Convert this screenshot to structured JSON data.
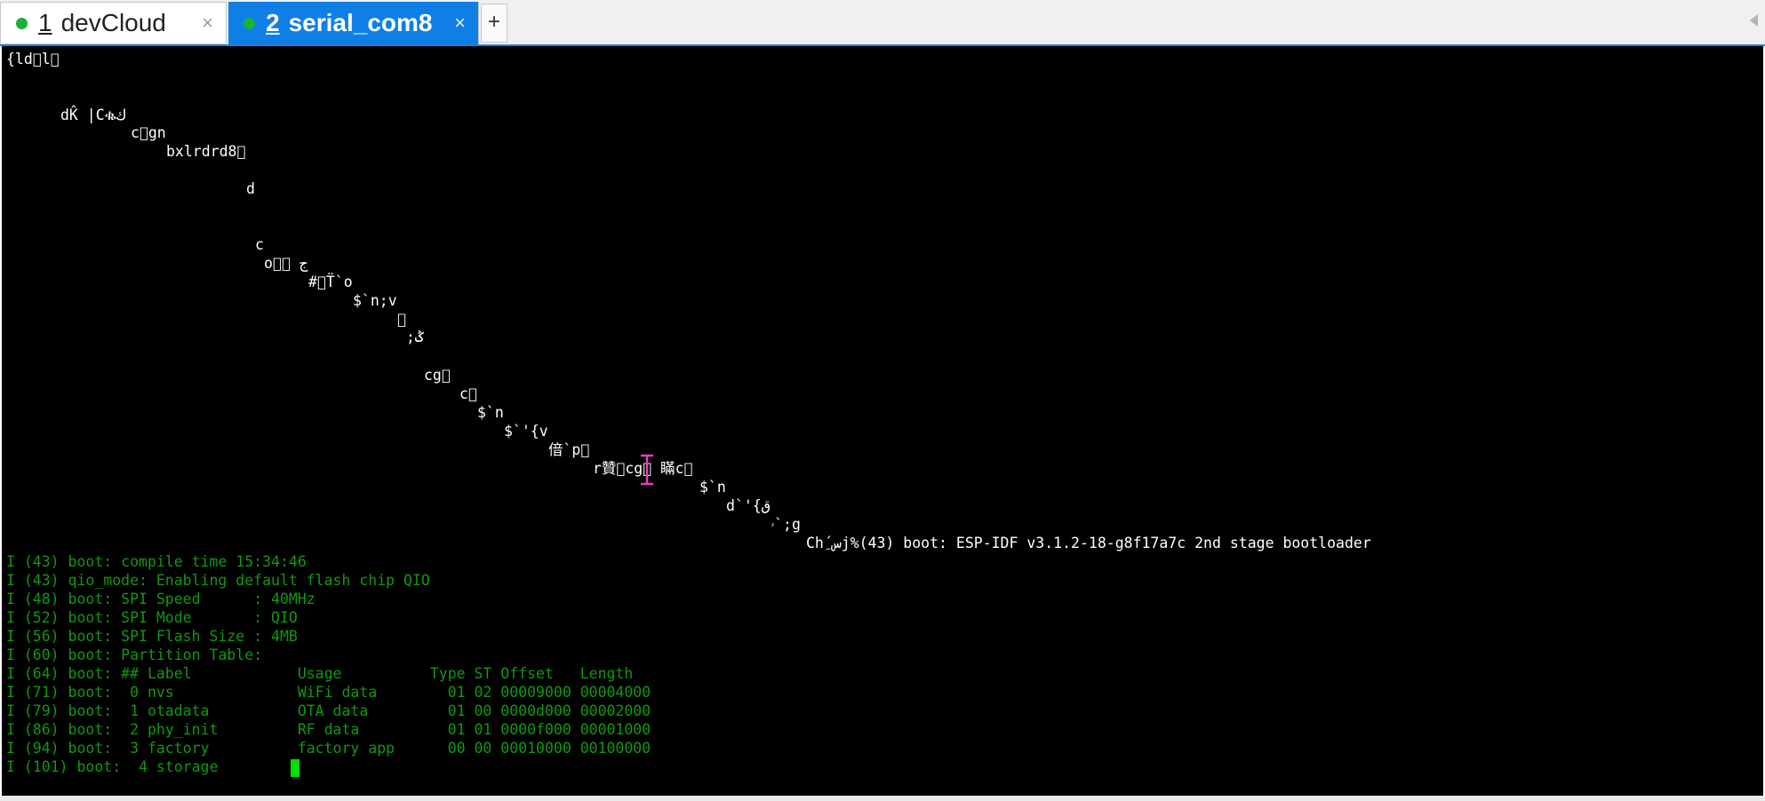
{
  "tabs": [
    {
      "number": "1",
      "title": "devCloud",
      "close": "×",
      "status_color": "#19b23a",
      "active": false
    },
    {
      "number": "2",
      "title": "serial_com8",
      "close": "×",
      "status_color": "#19b23a",
      "active": true
    }
  ],
  "new_tab_label": "+",
  "terminal": {
    "garbled": [
      "{ld\u0000l\u0000",
      "dK̂ |Cቈك",
      "c\u0000gn",
      "bxlrdrd8\u0000",
      "d",
      "c",
      "o\u0000㉘ ج",
      "#\u0000T̈`o",
      "$`n;v",
      "\u0000",
      ";ݣ",
      "cg\u0000",
      "c\u0000",
      "$`n",
      "$`'{v",
      "偣`p\u0000",
      "r贊\u0000cg\u0000 瞞c\u0000",
      "$`n",
      "d`'{ق",
      "ۥ`;g"
    ],
    "boot_header": "Ch´ِسj%(43) boot: ESP-IDF v3.1.2-18-g8f17a7c 2nd stage bootloader",
    "boot_lines": [
      "I (43) boot: compile time 15:34:46",
      "I (43) qio_mode: Enabling default flash chip QIO",
      "I (48) boot: SPI Speed      : 40MHz",
      "I (52) boot: SPI Mode       : QIO",
      "I (56) boot: SPI Flash Size : 4MB",
      "I (60) boot: Partition Table:",
      "I (64) boot: ## Label            Usage          Type ST Offset   Length",
      "I (71) boot:  0 nvs              WiFi data        01 02 00009000 00004000",
      "I (79) boot:  1 otadata          OTA data         01 00 0000d000 00002000",
      "I (86) boot:  2 phy_init         RF data          01 01 0000f000 00001000",
      "I (94) boot:  3 factory          factory app      00 00 00010000 00100000",
      "I (101) boot:  4 storage"
    ]
  }
}
